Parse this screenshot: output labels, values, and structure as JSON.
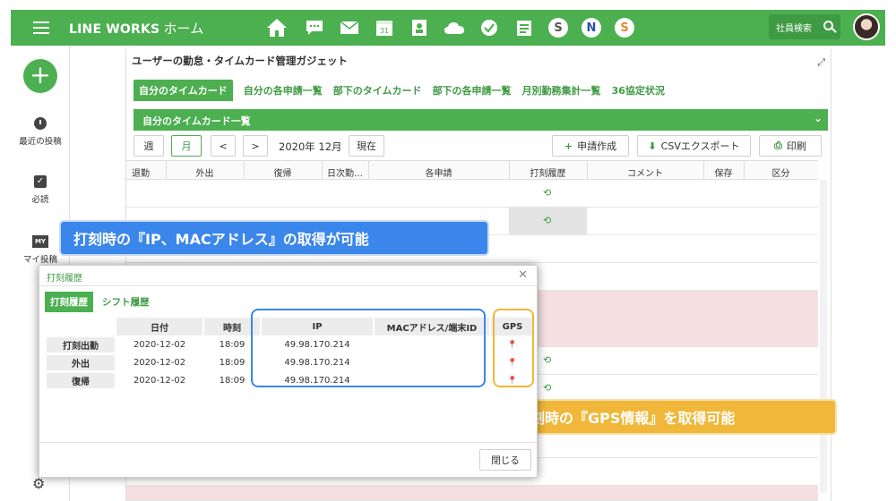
{
  "topbar": {
    "brand": "LINE WORKS",
    "brand_sub": "ホーム",
    "search_label": "社員検索"
  },
  "app_icons": [
    "home-icon",
    "chat-icon",
    "mail-icon",
    "calendar-icon",
    "contacts-icon",
    "drive-icon",
    "task-icon",
    "survey-icon",
    "s-app-icon",
    "n-app-icon",
    "s-app-icon-2"
  ],
  "calendar_day": "31",
  "app_badges": {
    "s1": "S",
    "n": "N",
    "s2": "S"
  },
  "leftnav": {
    "recent": "最近の投稿",
    "must_read": "必読",
    "my_badge": "MY",
    "my_posts": "マイ投稿"
  },
  "panel": {
    "title": "ユーザーの勤怠・タイムカード管理ガジェット",
    "tabs": [
      "自分のタイムカード",
      "自分の各申請一覧",
      "部下のタイムカード",
      "部下の各申請一覧",
      "月別勤務集計一覧",
      "36協定状況"
    ],
    "section": "自分のタイムカード一覧",
    "toolbar": {
      "week": "週",
      "month": "月",
      "prev": "<",
      "next": ">",
      "current_month": "2020年 12月",
      "today": "現在",
      "apply": "申請作成",
      "csv": "CSVエクスポート",
      "print": "印刷"
    },
    "columns": [
      "退勤",
      "外出",
      "復帰",
      "日次勤…",
      "各申請",
      "打刻履歴",
      "コメント",
      "保存",
      "区分"
    ]
  },
  "callouts": {
    "blue": "打刻時の『IP、MACアドレス』の取得が可能",
    "yellow": "打刻時の『GPS情報』を取得可能"
  },
  "dialog": {
    "title": "打刻履歴",
    "tabs": [
      "打刻履歴",
      "シフト履歴"
    ],
    "headers": [
      "日付",
      "時刻",
      "IP",
      "MACアドレス/端末ID",
      "GPS"
    ],
    "rows": [
      {
        "label": "打刻出勤",
        "date": "2020-12-02",
        "time": "18:09",
        "ip": "49.98.170.214",
        "mac": ""
      },
      {
        "label": "外出",
        "date": "2020-12-02",
        "time": "18:09",
        "ip": "49.98.170.214",
        "mac": ""
      },
      {
        "label": "復帰",
        "date": "2020-12-02",
        "time": "18:09",
        "ip": "49.98.170.214",
        "mac": ""
      }
    ],
    "close": "閉じる"
  },
  "colors": {
    "brand_green": "#4caf50",
    "highlight_blue": "#3b86ea",
    "highlight_yellow": "#f0b73a",
    "row_pink": "#f6dfe0"
  }
}
